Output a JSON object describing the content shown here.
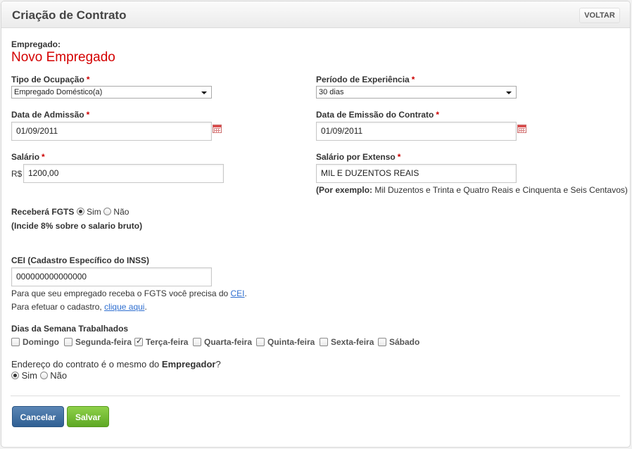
{
  "header": {
    "title": "Criação de Contrato",
    "back_label": "VOLTAR"
  },
  "employee": {
    "label": "Empregado:",
    "name": "Novo Empregado"
  },
  "occupation": {
    "label": "Tipo de Ocupação",
    "required": "*",
    "value": "Empregado Doméstico(a)"
  },
  "trial": {
    "label": "Período de Experiência",
    "required": "*",
    "value": "30 dias"
  },
  "admission": {
    "label": "Data de Admissão",
    "required": "*",
    "value": "01/09/2011"
  },
  "emission": {
    "label": "Data de Emissão do Contrato",
    "required": "*",
    "value": "01/09/2011"
  },
  "salary": {
    "label": "Salário",
    "required": "*",
    "currency": "R$",
    "value": "1200,00"
  },
  "salary_words": {
    "label": "Salário por Extenso",
    "required": "*",
    "value": "MIL E DUZENTOS REAIS",
    "example_prefix": "(Por exemplo:",
    "example_text": " Mil Duzentos e Trinta e Quatro Reais e Cinquenta e Seis Centavos)"
  },
  "fgts": {
    "label": "Receberá FGTS",
    "yes": "Sim",
    "no": "Não",
    "selected": "yes",
    "note_prefix": "(Incide ",
    "note_bold": "8% sobre o salario bruto",
    "note_suffix": ")"
  },
  "cei": {
    "label": "CEI (Cadastro Específico do INSS)",
    "value": "000000000000000",
    "help1_text": "Para que seu empregado receba o FGTS você precisa do ",
    "help1_link": "CEI",
    "help1_end": ".",
    "help2_text": "Para efetuar o cadastro, ",
    "help2_link": "clique aqui",
    "help2_end": "."
  },
  "days": {
    "label": "Dias da Semana Trabalhados",
    "items": [
      {
        "label": "Domingo",
        "checked": false
      },
      {
        "label": "Segunda-feira",
        "checked": false
      },
      {
        "label": "Terça-feira",
        "checked": true
      },
      {
        "label": "Quarta-feira",
        "checked": false
      },
      {
        "label": "Quinta-feira",
        "checked": false
      },
      {
        "label": "Sexta-feira",
        "checked": false
      },
      {
        "label": "Sábado",
        "checked": false
      }
    ]
  },
  "address": {
    "question_prefix": "Endereço do contrato é o mesmo do ",
    "question_bold": "Empregador",
    "question_suffix": "?",
    "yes": "Sim",
    "no": "Não",
    "selected": "yes"
  },
  "actions": {
    "cancel": "Cancelar",
    "save": "Salvar"
  }
}
